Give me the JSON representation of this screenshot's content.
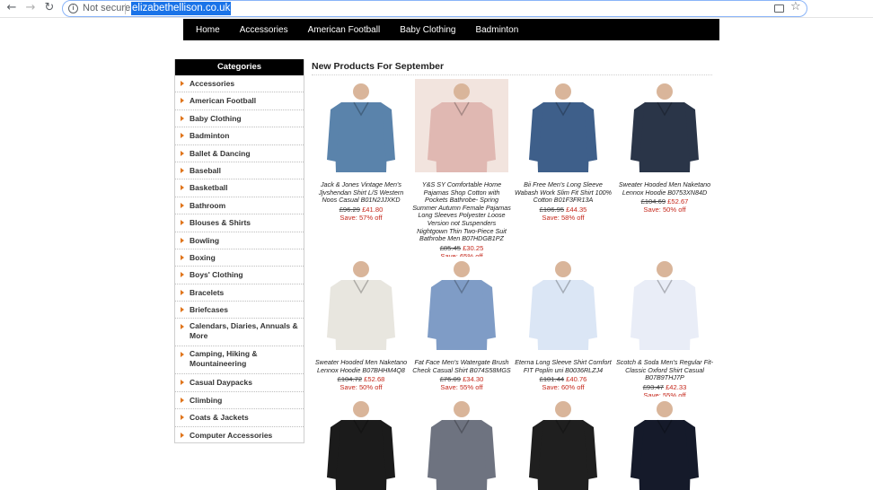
{
  "browser": {
    "security_label": "Not secure",
    "url": "elizabethellison.co.uk",
    "back_icon": "←",
    "forward_icon": "→",
    "reload_icon": "↻",
    "star_icon": "☆"
  },
  "topnav": {
    "items": [
      "Home",
      "Accessories",
      "American Football",
      "Baby Clothing",
      "Badminton"
    ]
  },
  "sidebar": {
    "title": "Categories",
    "items": [
      "Accessories",
      "American Football",
      "Baby Clothing",
      "Badminton",
      "Ballet & Dancing",
      "Baseball",
      "Basketball",
      "Bathroom",
      "Blouses & Shirts",
      "Bowling",
      "Boxing",
      "Boys' Clothing",
      "Bracelets",
      "Briefcases",
      "Calendars, Diaries, Annuals & More",
      "Camping, Hiking & Mountaineering",
      "Casual Daypacks",
      "Climbing",
      "Coats & Jackets",
      "Computer Accessories"
    ]
  },
  "main": {
    "heading": "New Products For September",
    "products": [
      {
        "title": "Jack & Jones Vintage Men's Jjvshendan Shirt L/S Western Noos Casual B01N2JJXKD",
        "old_price": "£96.29",
        "new_price": "£41.80",
        "save": "Save: 57% off",
        "accent": "#5a83ab"
      },
      {
        "title": "Y&S SY Comfortable Home Pajamas Shop Cotton with Pockets Bathrobe- Spring Summer Autumn Female Pajamas Long Sleeves Polyester Loose Version not Suspenders Nightgown Thin Two-Piece Suit Bathrobe Men B07HDGB1PZ",
        "old_price": "£85.45",
        "new_price": "£30.25",
        "save": "Save: 65% off",
        "accent": "#e0b8b2"
      },
      {
        "title": "Bii Free Men's Long Sleeve Wabash Work Slim Fit Shirt 100% Cotton B01F3FR13A",
        "old_price": "£106.95",
        "new_price": "£44.35",
        "save": "Save: 58% off",
        "accent": "#3e5f8a"
      },
      {
        "title": "Sweater Hooded Men Naketano Lennox Hoodie B0753XN84D",
        "old_price": "£104.69",
        "new_price": "£52.67",
        "save": "Save: 50% off",
        "accent": "#2a3548"
      },
      {
        "title": "Sweater Hooded Men Naketano Lennox Hoodie B07BHHM4Q8",
        "old_price": "£104.72",
        "new_price": "£52.68",
        "save": "Save: 50% off",
        "accent": "#e8e6df"
      },
      {
        "title": "Fat Face Men's Watergate Brush Check Casual Shirt B074S58MGS",
        "old_price": "£76.09",
        "new_price": "£34.30",
        "save": "Save: 55% off",
        "accent": "#7f9cc6"
      },
      {
        "title": "Eterna Long Sleeve Shirt Comfort FIT Poplin uni B0036RLZJ4",
        "old_price": "£101.44",
        "new_price": "£40.76",
        "save": "Save: 60% off",
        "accent": "#dbe6f5"
      },
      {
        "title": "Scotch & Soda Men's Regular Fit-Classic Oxford Shirt Casual B07B9THJ7P",
        "old_price": "£93.47",
        "new_price": "£42.33",
        "save": "Save: 55% off",
        "accent": "#e9edf7"
      },
      {
        "accent": "#1b1b1b"
      },
      {
        "accent": "#6e7380"
      },
      {
        "accent": "#1f1f1f"
      },
      {
        "accent": "#151a2a"
      }
    ]
  }
}
